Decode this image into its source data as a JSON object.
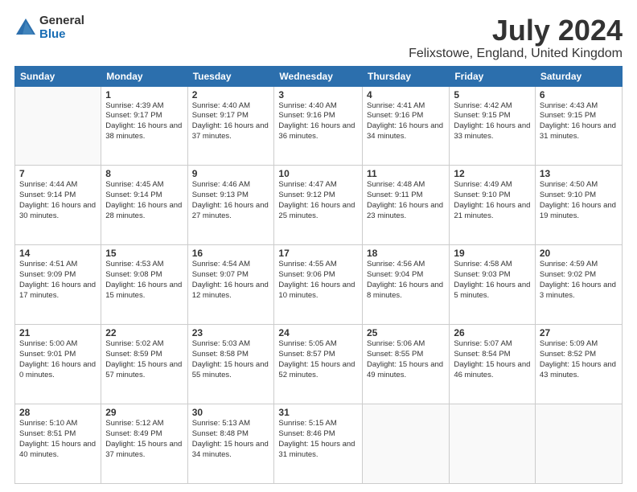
{
  "logo": {
    "general": "General",
    "blue": "Blue"
  },
  "title": "July 2024",
  "subtitle": "Felixstowe, England, United Kingdom",
  "days_header": [
    "Sunday",
    "Monday",
    "Tuesday",
    "Wednesday",
    "Thursday",
    "Friday",
    "Saturday"
  ],
  "weeks": [
    [
      {
        "day": "",
        "info": ""
      },
      {
        "day": "1",
        "info": "Sunrise: 4:39 AM\nSunset: 9:17 PM\nDaylight: 16 hours\nand 38 minutes."
      },
      {
        "day": "2",
        "info": "Sunrise: 4:40 AM\nSunset: 9:17 PM\nDaylight: 16 hours\nand 37 minutes."
      },
      {
        "day": "3",
        "info": "Sunrise: 4:40 AM\nSunset: 9:16 PM\nDaylight: 16 hours\nand 36 minutes."
      },
      {
        "day": "4",
        "info": "Sunrise: 4:41 AM\nSunset: 9:16 PM\nDaylight: 16 hours\nand 34 minutes."
      },
      {
        "day": "5",
        "info": "Sunrise: 4:42 AM\nSunset: 9:15 PM\nDaylight: 16 hours\nand 33 minutes."
      },
      {
        "day": "6",
        "info": "Sunrise: 4:43 AM\nSunset: 9:15 PM\nDaylight: 16 hours\nand 31 minutes."
      }
    ],
    [
      {
        "day": "7",
        "info": "Sunrise: 4:44 AM\nSunset: 9:14 PM\nDaylight: 16 hours\nand 30 minutes."
      },
      {
        "day": "8",
        "info": "Sunrise: 4:45 AM\nSunset: 9:14 PM\nDaylight: 16 hours\nand 28 minutes."
      },
      {
        "day": "9",
        "info": "Sunrise: 4:46 AM\nSunset: 9:13 PM\nDaylight: 16 hours\nand 27 minutes."
      },
      {
        "day": "10",
        "info": "Sunrise: 4:47 AM\nSunset: 9:12 PM\nDaylight: 16 hours\nand 25 minutes."
      },
      {
        "day": "11",
        "info": "Sunrise: 4:48 AM\nSunset: 9:11 PM\nDaylight: 16 hours\nand 23 minutes."
      },
      {
        "day": "12",
        "info": "Sunrise: 4:49 AM\nSunset: 9:10 PM\nDaylight: 16 hours\nand 21 minutes."
      },
      {
        "day": "13",
        "info": "Sunrise: 4:50 AM\nSunset: 9:10 PM\nDaylight: 16 hours\nand 19 minutes."
      }
    ],
    [
      {
        "day": "14",
        "info": "Sunrise: 4:51 AM\nSunset: 9:09 PM\nDaylight: 16 hours\nand 17 minutes."
      },
      {
        "day": "15",
        "info": "Sunrise: 4:53 AM\nSunset: 9:08 PM\nDaylight: 16 hours\nand 15 minutes."
      },
      {
        "day": "16",
        "info": "Sunrise: 4:54 AM\nSunset: 9:07 PM\nDaylight: 16 hours\nand 12 minutes."
      },
      {
        "day": "17",
        "info": "Sunrise: 4:55 AM\nSunset: 9:06 PM\nDaylight: 16 hours\nand 10 minutes."
      },
      {
        "day": "18",
        "info": "Sunrise: 4:56 AM\nSunset: 9:04 PM\nDaylight: 16 hours\nand 8 minutes."
      },
      {
        "day": "19",
        "info": "Sunrise: 4:58 AM\nSunset: 9:03 PM\nDaylight: 16 hours\nand 5 minutes."
      },
      {
        "day": "20",
        "info": "Sunrise: 4:59 AM\nSunset: 9:02 PM\nDaylight: 16 hours\nand 3 minutes."
      }
    ],
    [
      {
        "day": "21",
        "info": "Sunrise: 5:00 AM\nSunset: 9:01 PM\nDaylight: 16 hours\nand 0 minutes."
      },
      {
        "day": "22",
        "info": "Sunrise: 5:02 AM\nSunset: 8:59 PM\nDaylight: 15 hours\nand 57 minutes."
      },
      {
        "day": "23",
        "info": "Sunrise: 5:03 AM\nSunset: 8:58 PM\nDaylight: 15 hours\nand 55 minutes."
      },
      {
        "day": "24",
        "info": "Sunrise: 5:05 AM\nSunset: 8:57 PM\nDaylight: 15 hours\nand 52 minutes."
      },
      {
        "day": "25",
        "info": "Sunrise: 5:06 AM\nSunset: 8:55 PM\nDaylight: 15 hours\nand 49 minutes."
      },
      {
        "day": "26",
        "info": "Sunrise: 5:07 AM\nSunset: 8:54 PM\nDaylight: 15 hours\nand 46 minutes."
      },
      {
        "day": "27",
        "info": "Sunrise: 5:09 AM\nSunset: 8:52 PM\nDaylight: 15 hours\nand 43 minutes."
      }
    ],
    [
      {
        "day": "28",
        "info": "Sunrise: 5:10 AM\nSunset: 8:51 PM\nDaylight: 15 hours\nand 40 minutes."
      },
      {
        "day": "29",
        "info": "Sunrise: 5:12 AM\nSunset: 8:49 PM\nDaylight: 15 hours\nand 37 minutes."
      },
      {
        "day": "30",
        "info": "Sunrise: 5:13 AM\nSunset: 8:48 PM\nDaylight: 15 hours\nand 34 minutes."
      },
      {
        "day": "31",
        "info": "Sunrise: 5:15 AM\nSunset: 8:46 PM\nDaylight: 15 hours\nand 31 minutes."
      },
      {
        "day": "",
        "info": ""
      },
      {
        "day": "",
        "info": ""
      },
      {
        "day": "",
        "info": ""
      }
    ]
  ]
}
